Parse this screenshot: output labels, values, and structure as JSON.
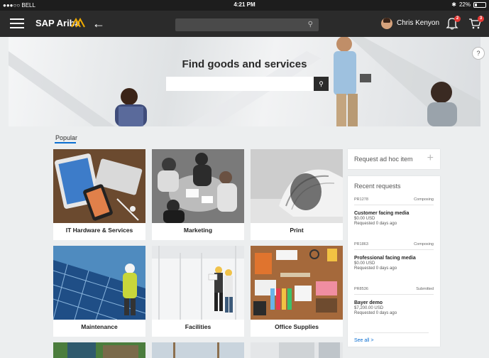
{
  "status_bar": {
    "carrier": "●●●○○ BELL",
    "time": "4:21 PM",
    "battery": "22%",
    "battery_level": 0.22
  },
  "shell": {
    "brand": "SAP Ariba",
    "search_placeholder": "",
    "user_name": "Chris Kenyon",
    "notification_count": "2",
    "cart_count": "3"
  },
  "hero": {
    "title": "Find goods and services",
    "search_placeholder": ""
  },
  "popular": {
    "tab_label": "Popular",
    "tiles": [
      {
        "label": "IT Hardware & Services"
      },
      {
        "label": "Marketing"
      },
      {
        "label": "Print"
      },
      {
        "label": "Maintenance"
      },
      {
        "label": "Facilities"
      },
      {
        "label": "Office Supplies"
      }
    ]
  },
  "adhoc": {
    "label": "Request ad hoc item"
  },
  "recent": {
    "title": "Recent requests",
    "items": [
      {
        "id": "PR1278",
        "status": "Composing",
        "name": "Customer facing media",
        "amount": "$0.00 USD",
        "when": "Requested 0 days ago"
      },
      {
        "id": "PR1863",
        "status": "Composing",
        "name": "Professional facing media",
        "amount": "$0.00 USD",
        "when": "Requested 0 days ago"
      },
      {
        "id": "PR8536",
        "status": "Submitted",
        "name": "Bayer demo",
        "amount": "$7,200.00 USD",
        "when": "Requested 0 days ago"
      }
    ],
    "see_all": "See all  >"
  },
  "colors": {
    "shell_bg": "#2b2b2b",
    "accent_blue": "#0a6ed1",
    "brand_gold": "#f0ab00",
    "badge_red": "#e53935"
  }
}
